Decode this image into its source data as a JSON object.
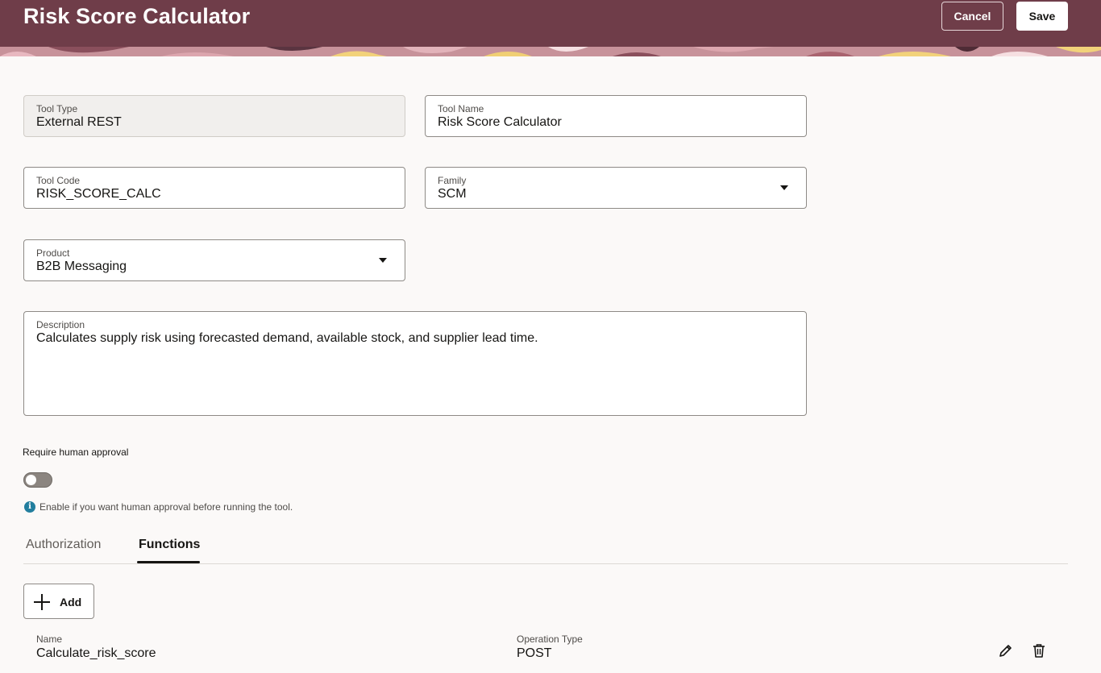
{
  "header": {
    "title": "Risk Score Calculator",
    "cancel_label": "Cancel",
    "save_label": "Save"
  },
  "form": {
    "tool_type": {
      "label": "Tool Type",
      "value": "External REST"
    },
    "tool_name": {
      "label": "Tool Name",
      "value": "Risk Score Calculator"
    },
    "tool_code": {
      "label": "Tool Code",
      "value": "RISK_SCORE_CALC"
    },
    "family": {
      "label": "Family",
      "value": "SCM"
    },
    "product": {
      "label": "Product",
      "value": "B2B Messaging"
    },
    "description": {
      "label": "Description",
      "value": "Calculates supply risk using forecasted demand, available stock, and supplier lead time."
    },
    "approval": {
      "label": "Require human approval",
      "enabled": false,
      "helper": "Enable if you want human approval before running the tool."
    }
  },
  "tabs": [
    {
      "label": "Authorization",
      "active": false
    },
    {
      "label": "Functions",
      "active": true
    }
  ],
  "functions": {
    "add_label": "Add",
    "columns": {
      "name": "Name",
      "operation_type": "Operation Type"
    },
    "rows": [
      {
        "name": "Calculate_risk_score",
        "operation_type": "POST"
      }
    ]
  },
  "icons": {
    "info": "info-icon",
    "add": "plus-icon",
    "edit": "pencil-icon",
    "delete": "trash-icon",
    "dropdown": "caret-down-icon"
  },
  "colors": {
    "header_bg": "#6f3d49",
    "page_bg": "#fbf9f8",
    "info_icon": "#227e9e",
    "toggle_off": "#8b8580"
  }
}
